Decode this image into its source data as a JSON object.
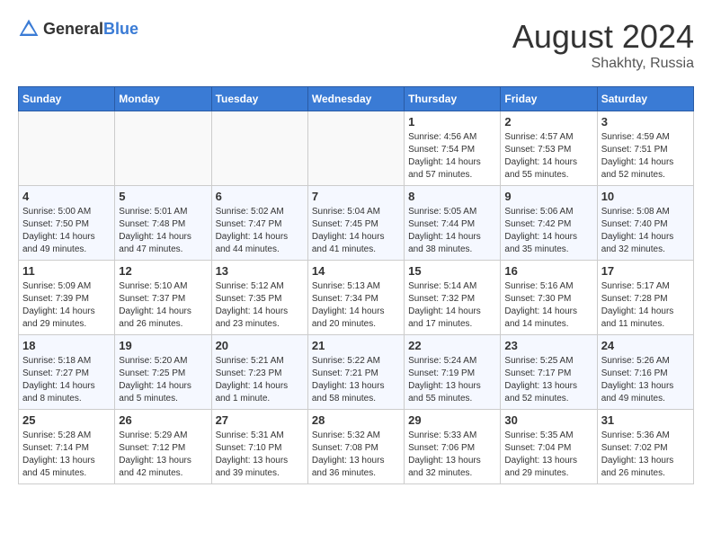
{
  "header": {
    "logo_general": "General",
    "logo_blue": "Blue",
    "month_year": "August 2024",
    "location": "Shakhty, Russia"
  },
  "weekdays": [
    "Sunday",
    "Monday",
    "Tuesday",
    "Wednesday",
    "Thursday",
    "Friday",
    "Saturday"
  ],
  "weeks": [
    [
      {
        "day": "",
        "info": ""
      },
      {
        "day": "",
        "info": ""
      },
      {
        "day": "",
        "info": ""
      },
      {
        "day": "",
        "info": ""
      },
      {
        "day": "1",
        "info": "Sunrise: 4:56 AM\nSunset: 7:54 PM\nDaylight: 14 hours\nand 57 minutes."
      },
      {
        "day": "2",
        "info": "Sunrise: 4:57 AM\nSunset: 7:53 PM\nDaylight: 14 hours\nand 55 minutes."
      },
      {
        "day": "3",
        "info": "Sunrise: 4:59 AM\nSunset: 7:51 PM\nDaylight: 14 hours\nand 52 minutes."
      }
    ],
    [
      {
        "day": "4",
        "info": "Sunrise: 5:00 AM\nSunset: 7:50 PM\nDaylight: 14 hours\nand 49 minutes."
      },
      {
        "day": "5",
        "info": "Sunrise: 5:01 AM\nSunset: 7:48 PM\nDaylight: 14 hours\nand 47 minutes."
      },
      {
        "day": "6",
        "info": "Sunrise: 5:02 AM\nSunset: 7:47 PM\nDaylight: 14 hours\nand 44 minutes."
      },
      {
        "day": "7",
        "info": "Sunrise: 5:04 AM\nSunset: 7:45 PM\nDaylight: 14 hours\nand 41 minutes."
      },
      {
        "day": "8",
        "info": "Sunrise: 5:05 AM\nSunset: 7:44 PM\nDaylight: 14 hours\nand 38 minutes."
      },
      {
        "day": "9",
        "info": "Sunrise: 5:06 AM\nSunset: 7:42 PM\nDaylight: 14 hours\nand 35 minutes."
      },
      {
        "day": "10",
        "info": "Sunrise: 5:08 AM\nSunset: 7:40 PM\nDaylight: 14 hours\nand 32 minutes."
      }
    ],
    [
      {
        "day": "11",
        "info": "Sunrise: 5:09 AM\nSunset: 7:39 PM\nDaylight: 14 hours\nand 29 minutes."
      },
      {
        "day": "12",
        "info": "Sunrise: 5:10 AM\nSunset: 7:37 PM\nDaylight: 14 hours\nand 26 minutes."
      },
      {
        "day": "13",
        "info": "Sunrise: 5:12 AM\nSunset: 7:35 PM\nDaylight: 14 hours\nand 23 minutes."
      },
      {
        "day": "14",
        "info": "Sunrise: 5:13 AM\nSunset: 7:34 PM\nDaylight: 14 hours\nand 20 minutes."
      },
      {
        "day": "15",
        "info": "Sunrise: 5:14 AM\nSunset: 7:32 PM\nDaylight: 14 hours\nand 17 minutes."
      },
      {
        "day": "16",
        "info": "Sunrise: 5:16 AM\nSunset: 7:30 PM\nDaylight: 14 hours\nand 14 minutes."
      },
      {
        "day": "17",
        "info": "Sunrise: 5:17 AM\nSunset: 7:28 PM\nDaylight: 14 hours\nand 11 minutes."
      }
    ],
    [
      {
        "day": "18",
        "info": "Sunrise: 5:18 AM\nSunset: 7:27 PM\nDaylight: 14 hours\nand 8 minutes."
      },
      {
        "day": "19",
        "info": "Sunrise: 5:20 AM\nSunset: 7:25 PM\nDaylight: 14 hours\nand 5 minutes."
      },
      {
        "day": "20",
        "info": "Sunrise: 5:21 AM\nSunset: 7:23 PM\nDaylight: 14 hours\nand 1 minute."
      },
      {
        "day": "21",
        "info": "Sunrise: 5:22 AM\nSunset: 7:21 PM\nDaylight: 13 hours\nand 58 minutes."
      },
      {
        "day": "22",
        "info": "Sunrise: 5:24 AM\nSunset: 7:19 PM\nDaylight: 13 hours\nand 55 minutes."
      },
      {
        "day": "23",
        "info": "Sunrise: 5:25 AM\nSunset: 7:17 PM\nDaylight: 13 hours\nand 52 minutes."
      },
      {
        "day": "24",
        "info": "Sunrise: 5:26 AM\nSunset: 7:16 PM\nDaylight: 13 hours\nand 49 minutes."
      }
    ],
    [
      {
        "day": "25",
        "info": "Sunrise: 5:28 AM\nSunset: 7:14 PM\nDaylight: 13 hours\nand 45 minutes."
      },
      {
        "day": "26",
        "info": "Sunrise: 5:29 AM\nSunset: 7:12 PM\nDaylight: 13 hours\nand 42 minutes."
      },
      {
        "day": "27",
        "info": "Sunrise: 5:31 AM\nSunset: 7:10 PM\nDaylight: 13 hours\nand 39 minutes."
      },
      {
        "day": "28",
        "info": "Sunrise: 5:32 AM\nSunset: 7:08 PM\nDaylight: 13 hours\nand 36 minutes."
      },
      {
        "day": "29",
        "info": "Sunrise: 5:33 AM\nSunset: 7:06 PM\nDaylight: 13 hours\nand 32 minutes."
      },
      {
        "day": "30",
        "info": "Sunrise: 5:35 AM\nSunset: 7:04 PM\nDaylight: 13 hours\nand 29 minutes."
      },
      {
        "day": "31",
        "info": "Sunrise: 5:36 AM\nSunset: 7:02 PM\nDaylight: 13 hours\nand 26 minutes."
      }
    ]
  ]
}
